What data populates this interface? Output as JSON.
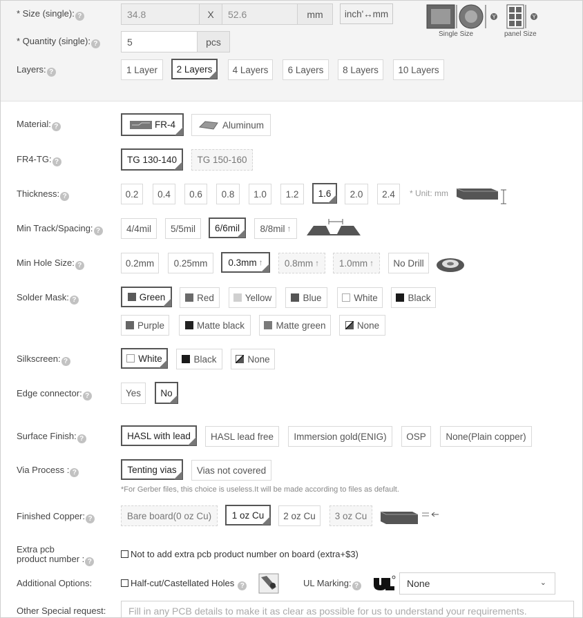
{
  "size": {
    "label": "* Size (single):",
    "width": "34.8",
    "sep": "X",
    "height": "52.6",
    "unit": "mm",
    "convert_label": "inch'↔mm",
    "single_size_caption": "Single Size",
    "panel_size_caption": "panel Size"
  },
  "quantity": {
    "label": "* Quantity (single):",
    "value": "5",
    "unit": "pcs"
  },
  "layers": {
    "label": "Layers:",
    "options": [
      "1 Layer",
      "2 Layers",
      "4 Layers",
      "6 Layers",
      "8 Layers",
      "10 Layers"
    ],
    "selected": "2 Layers"
  },
  "material": {
    "label": "Material:",
    "options": [
      "FR-4",
      "Aluminum"
    ],
    "selected": "FR-4"
  },
  "fr4_tg": {
    "label": "FR4-TG:",
    "options": [
      "TG 130-140",
      "TG 150-160"
    ],
    "selected": "TG 130-140"
  },
  "thickness": {
    "label": "Thickness:",
    "options": [
      "0.2",
      "0.4",
      "0.6",
      "0.8",
      "1.0",
      "1.2",
      "1.6",
      "2.0",
      "2.4"
    ],
    "selected": "1.6",
    "unit_note": "* Unit: mm"
  },
  "min_track": {
    "label": "Min Track/Spacing:",
    "options": [
      "4/4mil",
      "5/5mil",
      "6/6mil",
      "8/8mil"
    ],
    "selected": "6/6mil"
  },
  "min_hole": {
    "label": "Min Hole Size:",
    "options": [
      "0.2mm",
      "0.25mm",
      "0.3mm",
      "0.8mm",
      "1.0mm",
      "No Drill"
    ],
    "selected": "0.3mm"
  },
  "solder_mask": {
    "label": "Solder Mask:",
    "row1": [
      "Green",
      "Red",
      "Yellow",
      "Blue",
      "White",
      "Black"
    ],
    "row2": [
      "Purple",
      "Matte black",
      "Matte green",
      "None"
    ],
    "selected": "Green"
  },
  "silkscreen": {
    "label": "Silkscreen:",
    "options": [
      "White",
      "Black",
      "None"
    ],
    "selected": "White"
  },
  "edge_connector": {
    "label": "Edge connector:",
    "options": [
      "Yes",
      "No"
    ],
    "selected": "No"
  },
  "surface_finish": {
    "label": "Surface Finish:",
    "options": [
      "HASL with lead",
      "HASL lead free",
      "Immersion gold(ENIG)",
      "OSP",
      "None(Plain copper)"
    ],
    "selected": "HASL with lead"
  },
  "via_process": {
    "label": "Via Process :",
    "options": [
      "Tenting vias",
      "Vias not covered"
    ],
    "selected": "Tenting vias",
    "note": "*For Gerber files, this choice is useless.It will be made according to files as default."
  },
  "finished_copper": {
    "label": "Finished Copper:",
    "options": [
      "Bare board(0 oz Cu)",
      "1 oz Cu",
      "2 oz Cu",
      "3 oz Cu"
    ],
    "selected": "1 oz Cu"
  },
  "extra_pcb": {
    "label_line1": "Extra pcb",
    "label_line2": "product number :",
    "checkbox_label": "Not to add extra pcb product number on board (extra+$3)"
  },
  "additional": {
    "label": "Additional Options:",
    "half_cut_label": "Half-cut/Castellated Holes",
    "ul_label": "UL Marking:",
    "ul_value": "None"
  },
  "special": {
    "label": "Other Special request:",
    "placeholder": "Fill in any PCB details to make it as clear as possible for us to understand your requirements."
  },
  "colors": {
    "selected_border": "#555555",
    "option_border": "#d9d9d9",
    "top_panel_bg": "#f4f4f4"
  }
}
